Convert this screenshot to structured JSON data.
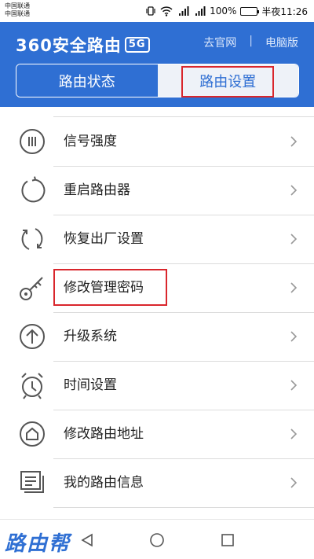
{
  "status_bar": {
    "carrier_1": "中国联通",
    "carrier_2": "中国联通",
    "battery_level": "100%",
    "time": "半夜11:26",
    "battery_color": "#2fb84f"
  },
  "header": {
    "logo_text": "360安全路由",
    "logo_badge": "5G",
    "link_official": "去官网",
    "link_separator": "|",
    "link_desktop": "电脑版",
    "brand_color": "#2f6fd3"
  },
  "tabs": [
    {
      "label": "路由状态",
      "selected": false
    },
    {
      "label": "路由设置",
      "selected": true
    }
  ],
  "menu": {
    "items": [
      {
        "label": "信号强度",
        "icon": "signal-strength-icon"
      },
      {
        "label": "重启路由器",
        "icon": "restart-icon"
      },
      {
        "label": "恢复出厂设置",
        "icon": "factory-reset-icon"
      },
      {
        "label": "修改管理密码",
        "icon": "key-icon"
      },
      {
        "label": "升级系统",
        "icon": "upgrade-icon"
      },
      {
        "label": "时间设置",
        "icon": "alarm-clock-icon"
      },
      {
        "label": "修改路由地址",
        "icon": "home-address-icon"
      },
      {
        "label": "我的路由信息",
        "icon": "router-info-icon"
      }
    ]
  },
  "nav": {
    "watermark": "路由帮"
  },
  "highlight_color": "#d9262c"
}
